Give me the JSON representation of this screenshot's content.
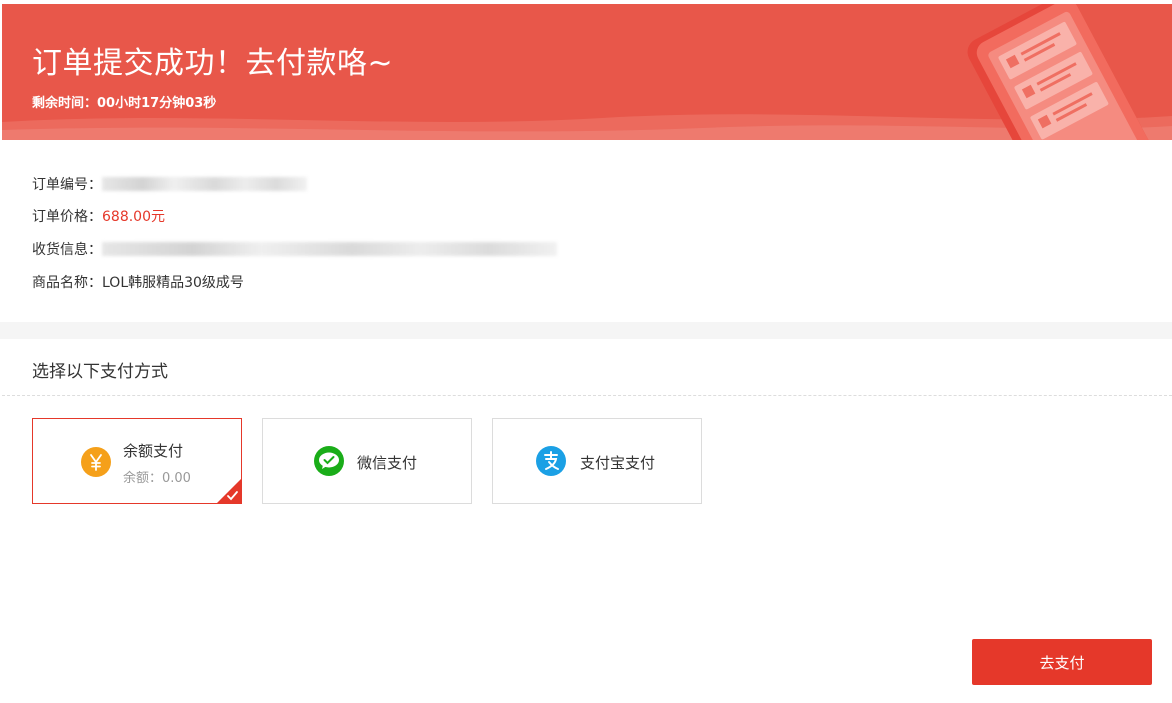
{
  "banner": {
    "title": "订单提交成功！去付款咯~",
    "timer_label": "剩余时间：",
    "timer_value": "00小时17分钟03秒",
    "accent_color": "#e8574a"
  },
  "order": {
    "number_label": "订单编号：",
    "price_label": "订单价格：",
    "price_value": "688.00元",
    "shipping_label": "收货信息：",
    "product_label": "商品名称：",
    "product_value": "LOL韩服精品30级成号",
    "price_color": "#e5382a"
  },
  "payment": {
    "heading": "选择以下支付方式",
    "options": [
      {
        "label": "余额支付",
        "sub_label": "余额：0.00",
        "icon": "yen-coin-icon",
        "icon_color": "#f5a01a",
        "selected": true
      },
      {
        "label": "微信支付",
        "icon": "wechat-icon",
        "icon_color": "#1aad19",
        "selected": false
      },
      {
        "label": "支付宝支付",
        "icon": "alipay-icon",
        "icon_color": "#1ba0e5",
        "selected": false
      }
    ],
    "submit_label": "去支付",
    "submit_color": "#e5382a"
  }
}
